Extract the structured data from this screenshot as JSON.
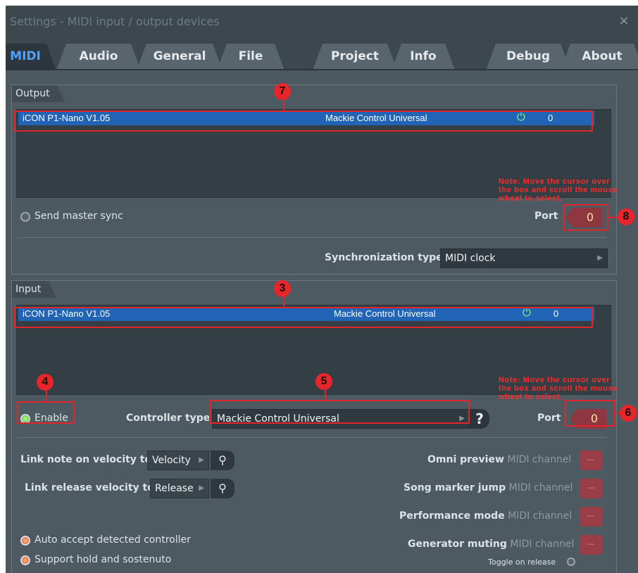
{
  "window": {
    "title": "Settings - MIDI input / output devices",
    "close": "×"
  },
  "tabs": [
    {
      "label": "MIDI",
      "active": true
    },
    {
      "label": "Audio"
    },
    {
      "label": "General"
    },
    {
      "label": "File"
    },
    {
      "label": "Project"
    },
    {
      "label": "Info"
    },
    {
      "label": "Debug"
    },
    {
      "label": "About"
    }
  ],
  "output": {
    "label": "Output",
    "row": {
      "name": "iCON P1-Nano V1.05",
      "type": "Mackie Control Universal",
      "power_icon": "⏻",
      "port": "0"
    },
    "send_master_sync": "Send master sync",
    "port_label": "Port",
    "port_value": "0",
    "sync_type_label": "Synchronization type",
    "sync_type_value": "MIDI clock"
  },
  "input": {
    "label": "Input",
    "row": {
      "name": "iCON P1-Nano V1.05",
      "type": "Mackie Control Universal",
      "power_icon": "⏻",
      "port": "0"
    },
    "enable": "Enable",
    "controller_type_label": "Controller type",
    "controller_type_value": "Mackie Control Universal",
    "help": "?",
    "port_label": "Port",
    "port_value": "0",
    "link_note_label": "Link note on velocity to",
    "link_note_value": "Velocity",
    "link_release_label": "Link release velocity to",
    "link_release_value": "Release",
    "link_icon": "⚲",
    "omni_label": "Omni preview",
    "song_marker_label": "Song marker jump",
    "performance_label": "Performance mode",
    "generator_muting_label": "Generator muting",
    "midi_channel": "MIDI channel",
    "channel_value": "---",
    "auto_accept": "Auto accept detected controller",
    "support_hold": "Support hold and sostenuto",
    "toggle_on_release": "Toggle on release"
  },
  "annotations": {
    "badges": [
      "7",
      "8",
      "3",
      "4",
      "5",
      "6"
    ],
    "note_text": "Note: Move the cursor over\nthe box and scroll the mouse\nwheel to select."
  },
  "colors": {
    "accent": "#4da3ff",
    "selection": "#2164b5",
    "annotation": "#e0262a",
    "port_box": "#8e3740"
  }
}
